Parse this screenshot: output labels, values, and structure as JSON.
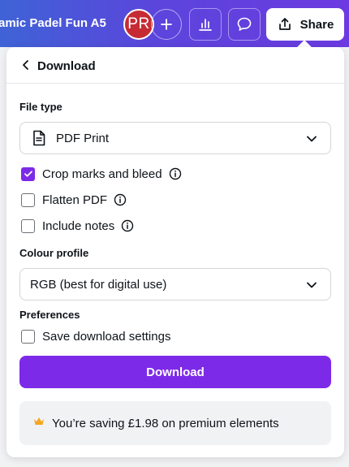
{
  "topbar": {
    "doc_title": "amic Padel Fun A5",
    "avatar_initials": "PR",
    "share_label": "Share",
    "icons": [
      "plus-icon",
      "analytics-icon",
      "comment-icon",
      "share-upload-icon"
    ]
  },
  "panel": {
    "title": "Download",
    "file_type": {
      "label": "File type",
      "value": "PDF Print",
      "icon": "document-icon"
    },
    "options": [
      {
        "label": "Crop marks and bleed",
        "checked": true
      },
      {
        "label": "Flatten PDF",
        "checked": false
      },
      {
        "label": "Include notes",
        "checked": false
      }
    ],
    "colour_profile": {
      "label": "Colour profile",
      "value": "RGB (best for digital use)"
    },
    "preferences": {
      "label": "Preferences",
      "save_settings_label": "Save download settings",
      "save_settings_checked": false
    },
    "download_button_label": "Download",
    "saving_message": "You’re saving £1.98 on premium elements"
  },
  "colors": {
    "accent": "#7d2ae8",
    "topbar_start": "#3f63d6",
    "topbar_end": "#6c3ae0",
    "avatar": "#c62b34",
    "crown": "#f5a623"
  }
}
